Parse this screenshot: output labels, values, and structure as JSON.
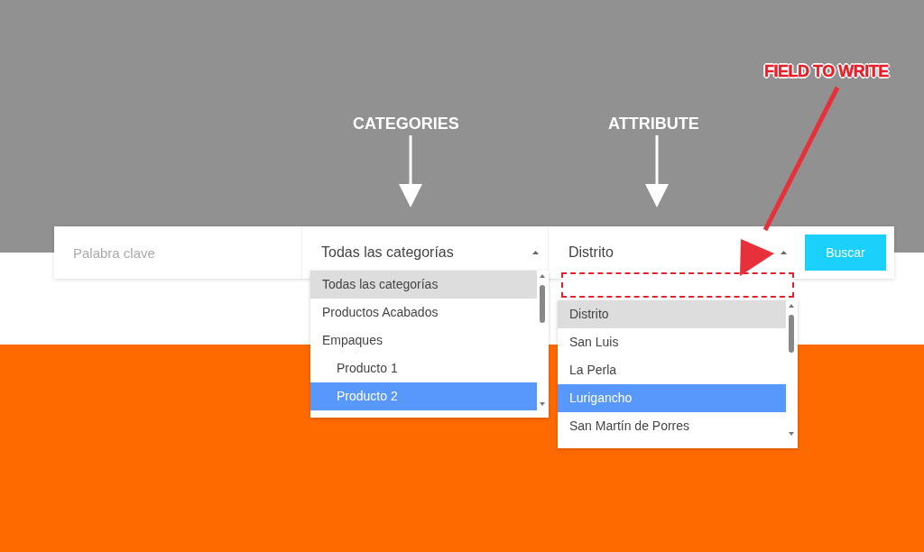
{
  "annotations": [
    {
      "kind": "white",
      "text": "CATEGORIES"
    },
    {
      "kind": "white",
      "text": "ATTRIBUTE"
    },
    {
      "kind": "red",
      "text": "FIELD TO WRITE"
    }
  ],
  "search_bar": {
    "keyword": {
      "placeholder": "Palabra clave"
    },
    "category_select": {
      "value": "Todas las categorías",
      "expanded": true
    },
    "attribute_select": {
      "value": "Distrito",
      "expanded": true
    },
    "button": "Buscar"
  },
  "category_dropdown": {
    "options": [
      {
        "label": "Todas las categorías",
        "current": true,
        "selected": false
      },
      {
        "label": "Productos Acabados",
        "current": false,
        "selected": false
      },
      {
        "label": "Empaques",
        "current": false,
        "selected": false,
        "children": [
          {
            "label": "Producto 1",
            "current": false,
            "selected": false
          },
          {
            "label": "Producto 2",
            "current": false,
            "selected": true
          }
        ]
      }
    ]
  },
  "attribute_dropdown": {
    "options": [
      {
        "label": "Distrito",
        "current": true,
        "selected": false
      },
      {
        "label": "San Luis",
        "current": false,
        "selected": false
      },
      {
        "label": "La Perla",
        "current": false,
        "selected": false
      },
      {
        "label": "Lurigancho",
        "current": false,
        "selected": true
      },
      {
        "label": "San Martín de Porres",
        "current": false,
        "selected": false
      }
    ]
  }
}
